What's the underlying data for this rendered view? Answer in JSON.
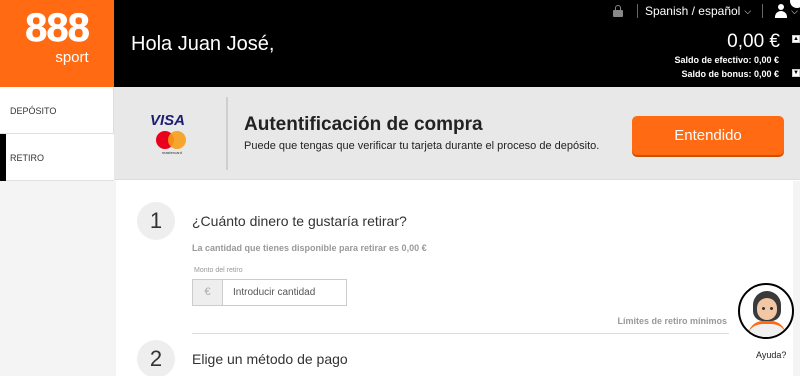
{
  "brand": {
    "logo_number": "888",
    "logo_word": "sport",
    "accent": "#ff6a13"
  },
  "header": {
    "greeting": "Hola Juan José,",
    "language": "Spanish / español",
    "balance": "0,00 €",
    "cash_balance": "Saldo de efectivo: 0,00 €",
    "bonus_balance": "Saldo de bonus: 0,00 €",
    "icons": [
      "lock-icon",
      "chevron-down-icon",
      "user-icon",
      "chevron-down-icon"
    ]
  },
  "sidebar": {
    "items": [
      {
        "label": "DEPÓSITO",
        "active": false
      },
      {
        "label": "RETIRO",
        "active": true
      }
    ]
  },
  "banner": {
    "visa_text": "VISA",
    "mastercard_text": "mastercard",
    "title": "Autentificación de compra",
    "subtitle": "Puede que tengas que verificar tu tarjeta durante el proceso de depósito.",
    "button_label": "Entendido"
  },
  "steps": {
    "step1": {
      "number": "1",
      "title": "¿Cuánto dinero te gustaría retirar?",
      "available": "La cantidad que tienes disponible para retirar es 0,00 €",
      "amount_label": "Monto del retiro",
      "currency_symbol": "€",
      "amount_placeholder": "Introducir cantidad",
      "limits_link": "Límites de retiro mínimos"
    },
    "step2": {
      "number": "2",
      "title": "Elige un método de pago"
    }
  },
  "help": {
    "label": "Ayuda?"
  }
}
